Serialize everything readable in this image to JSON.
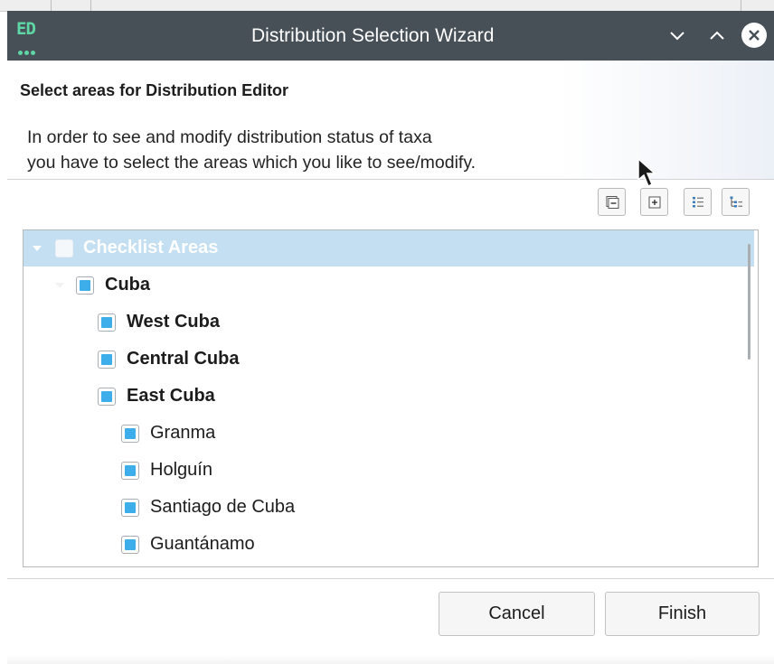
{
  "window": {
    "title": "Distribution Selection Wizard",
    "app_icon_text": "ED"
  },
  "header": {
    "title": "Select areas for Distribution Editor",
    "description_line1": "In order to see and modify distribution status of taxa",
    "description_line2": "you have to select the areas which you like to see/modify."
  },
  "toolbar": {
    "buttons": [
      "collapse-all",
      "expand-all",
      "flat-list",
      "tree-view"
    ]
  },
  "tree": {
    "items": [
      {
        "label": "Checklist Areas",
        "checked": false,
        "selected": true,
        "expanded": true
      },
      {
        "label": "Cuba",
        "checked": true,
        "expanded": true
      },
      {
        "label": "West Cuba",
        "checked": true
      },
      {
        "label": "Central Cuba",
        "checked": true
      },
      {
        "label": "East Cuba",
        "checked": true,
        "expanded": true
      },
      {
        "label": "Granma",
        "checked": true
      },
      {
        "label": "Holguín",
        "checked": true
      },
      {
        "label": "Santiago de Cuba",
        "checked": true
      },
      {
        "label": "Guantánamo",
        "checked": true
      }
    ]
  },
  "buttons": {
    "cancel": "Cancel",
    "finish": "Finish"
  },
  "colors": {
    "titlebar": "#475057",
    "accent": "#3daee9",
    "selection": "#c4dff2",
    "logo": "#5fd6a6"
  }
}
